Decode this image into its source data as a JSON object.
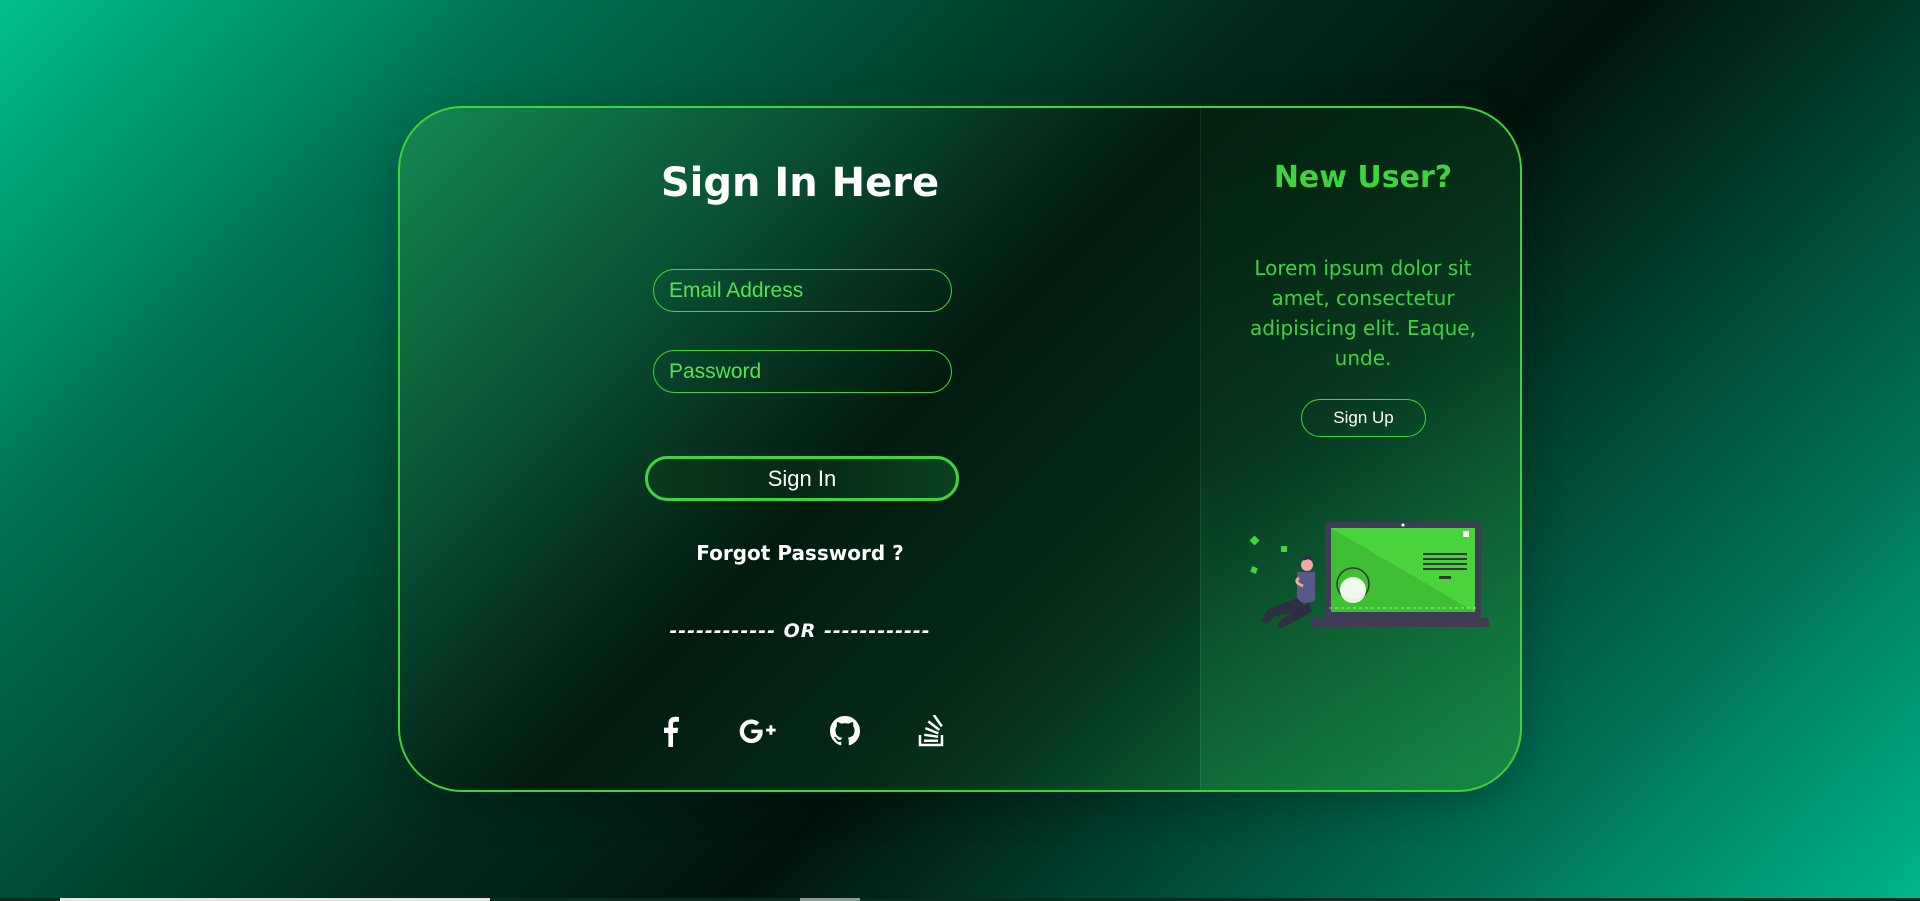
{
  "signin": {
    "title": "Sign In Here",
    "email_placeholder": "Email Address",
    "password_placeholder": "Password",
    "button_label": "Sign In",
    "forgot_label": "Forgot Password ?",
    "or_divider": "------------ OR ------------"
  },
  "social": {
    "icons": [
      "facebook-icon",
      "google-plus-icon",
      "github-icon",
      "stack-overflow-icon"
    ]
  },
  "signup_panel": {
    "title": "New User?",
    "description": "Lorem ipsum dolor sit amet, consectetur adipisicing elit. Eaque, unde.",
    "button_label": "Sign Up"
  },
  "colors": {
    "accent": "#3fd43f",
    "text": "#ffffff",
    "background_dark": "#01140c",
    "background_light": "#00c08c"
  }
}
